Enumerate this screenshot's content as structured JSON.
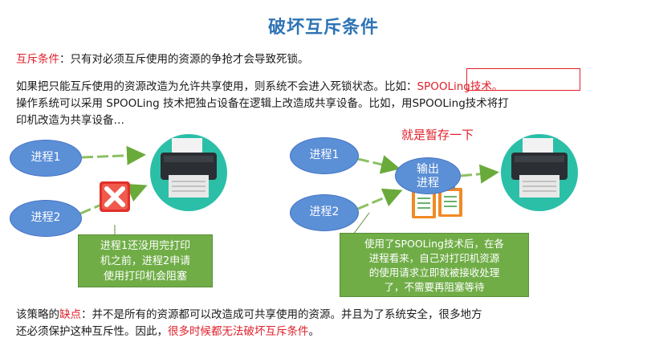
{
  "title": "破坏互斥条件",
  "intro": {
    "label": "互斥条件",
    "text": "：只有对必须互斥使用的资源的争抢才会导致死锁。"
  },
  "para": {
    "line1": "如果把只能互斥使用的资源改造为允许共享使用，则系统不会进入死锁状态。比如：",
    "example": "SPOOLing技术。",
    "line2": "操作系统可以采用 SPOOLing  技术把独占设备在逻辑上改造成共享设备。比如，用SPOOLing技术将打",
    "line3": "印机改造为共享设备…"
  },
  "left_diagram": {
    "process1": "进程1",
    "process2": "进程2",
    "callout": [
      "进程1还没用完打印",
      "机之前，进程2申请",
      "使用打印机会阻塞"
    ]
  },
  "right_diagram": {
    "note": "就是暂存一下",
    "process1": "进程1",
    "process2": "进程2",
    "output_process": [
      "输出",
      "进程"
    ],
    "callout": [
      "使用了SPOOLing技术后，在各",
      "进程看来，自己对打印机资源",
      "的使用请求立即就被接收处理",
      "了，不需要再阻塞等待"
    ]
  },
  "footer": {
    "line1_pre": "该策略的",
    "line1_red": "缺点",
    "line1_post": "：并不是所有的资源都可以改造成可共享使用的资源。并且为了系统安全，很多地方",
    "line2_pre": "还必须保护这种互斥性。因此，",
    "line2_red": "很多时候都无法破坏互斥条件",
    "line2_post": "。"
  },
  "colors": {
    "title": "#2e74b5",
    "accent_red": "#e0202a",
    "bubble": "#5b8fd6",
    "arrow": "#6aaa3a",
    "callout": "#70ad47",
    "printer_bg": "#2bbfa8"
  }
}
